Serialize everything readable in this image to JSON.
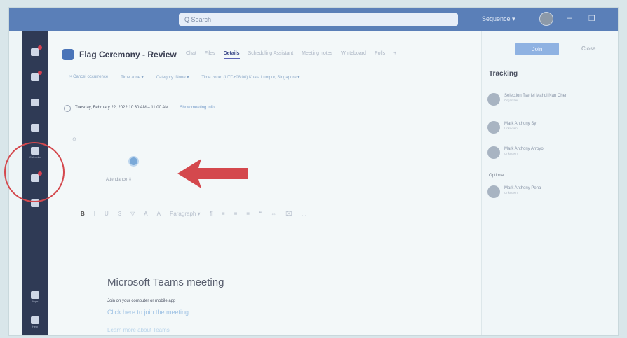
{
  "titlebar": {
    "search_placeholder": "Q Search",
    "user_name": "Sequence ▾",
    "min_glyph": "–",
    "restore_glyph": "❐"
  },
  "rail": {
    "items": [
      {
        "icon": "activity-icon",
        "label": ""
      },
      {
        "icon": "chat-icon",
        "label": ""
      },
      {
        "icon": "teams-icon",
        "label": ""
      },
      {
        "icon": "assignments-icon",
        "label": ""
      },
      {
        "icon": "calendar-icon",
        "label": "Calendar"
      },
      {
        "icon": "calls-icon",
        "label": ""
      },
      {
        "icon": "files-icon",
        "label": ""
      }
    ],
    "bottom_items": [
      {
        "icon": "apps-icon",
        "label": "Apps"
      },
      {
        "icon": "help-icon",
        "label": "Help"
      }
    ]
  },
  "meeting": {
    "title": "Flag Ceremony - Review",
    "tabs": [
      "Chat",
      "Files",
      "Details",
      "Scheduling Assistant",
      "Meeting notes",
      "Whiteboard",
      "Polls",
      "+"
    ],
    "active_tab_index": 2,
    "subbar": [
      "× Cancel occurrence",
      "Time zone ▾",
      "Category: None ▾",
      "Time zone: (UTC+08:00) Kuala Lumpur, Singapore ▾"
    ],
    "datetime": "Tuesday, February 22, 2022 10:30 AM – 11:00 AM",
    "recurrence": "Show meeting info",
    "attendee_label": "Attendance ⬇",
    "toolbar": [
      "B",
      "I",
      "U",
      "S",
      "▽",
      "A",
      "A",
      "Paragraph ▾",
      "¶",
      "≡",
      "≡",
      "≡",
      "❝",
      "⇔",
      "⌧",
      "…"
    ],
    "teams_meeting_title": "Microsoft Teams meeting",
    "join_text": "Join on your computer or mobile app",
    "join_link": "Click here to join the meeting",
    "learn_more": "Learn more about Teams"
  },
  "side": {
    "join_label": "Join",
    "close_label": "Close",
    "tracking_title": "Tracking",
    "people": [
      {
        "name": "Selection Tseriel Mahdi Nan Chen",
        "status": "Organizer"
      },
      {
        "name": "Mark Anthony Sy",
        "status": "Unknown"
      },
      {
        "name": "Mark Anthony Arroyo",
        "status": "Unknown"
      }
    ],
    "optional_label": "Optional",
    "optional_people": [
      {
        "name": "Mark Anthony Pena",
        "status": "Unknown"
      }
    ]
  },
  "colors": {
    "titlebar": "#5a7fb8",
    "rail": "#2f3a55",
    "annotation_red": "#d4484d",
    "accent": "#5b63b6"
  }
}
